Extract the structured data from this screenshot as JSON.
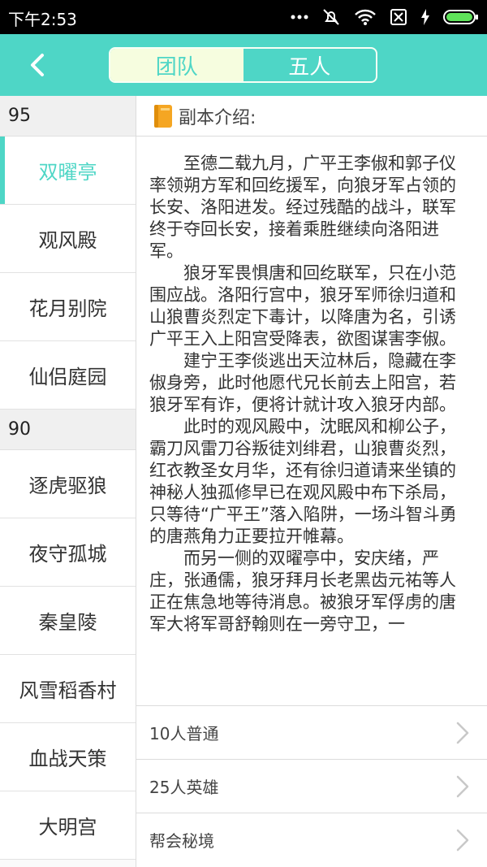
{
  "status": {
    "time": "下午2:53",
    "icons": [
      "more-dots-icon",
      "mute-icon",
      "wifi-icon",
      "sim-off-icon",
      "charging-icon",
      "battery-icon"
    ]
  },
  "header": {
    "tabs": [
      "团队",
      "五人"
    ],
    "active_tab": 0,
    "colors": {
      "accent": "#4ed6c6",
      "active_tab_bg": "#f6fddf"
    }
  },
  "sidebar": {
    "sections": [
      {
        "level": "95",
        "items": [
          "双曜亭",
          "观风殿",
          "花月别院",
          "仙侣庭园"
        ]
      },
      {
        "level": "90",
        "items": [
          "逐虎驱狼",
          "夜守孤城",
          "秦皇陵",
          "风雪稻香村",
          "血战天策",
          "大明宫"
        ]
      }
    ],
    "selected": "双曜亭"
  },
  "intro": {
    "heading": "副本介绍:",
    "paragraphs": [
      "至德二载九月，广平王李俶和郭子仪率领朔方军和回纥援军，向狼牙军占领的长安、洛阳进发。经过残酷的战斗，联军终于夺回长安，接着乘胜继续向洛阳进军。",
      "狼牙军畏惧唐和回纥联军，只在小范围应战。洛阳行宫中，狼牙军师徐归道和山狼曹炎烈定下毒计，以降唐为名，引诱广平王入上阳宫受降表，欲图谋害李俶。",
      "建宁王李倓逃出天泣林后，隐藏在李俶身旁，此时他愿代兄长前去上阳宫，若狼牙军有诈，便将计就计攻入狼牙内部。",
      "此时的观风殿中，沈眠风和柳公子，霸刀风雷刀谷叛徒刘绯君，山狼曹炎烈，红衣教圣女月华，还有徐归道请来坐镇的神秘人独孤修早已在观风殿中布下杀局，只等待“广平王”落入陷阱，一场斗智斗勇的唐燕角力正要拉开帷幕。",
      "而另一侧的双曜亭中，安庆绪，严庄，张通儒，狼牙拜月长老黑齿元祐等人正在焦急地等待消息。被狼牙军俘虏的唐军大将军哥舒翰则在一旁守卫，一"
    ]
  },
  "modes": [
    {
      "label": "10人普通",
      "icon": "chevron-right-icon"
    },
    {
      "label": "25人英雄",
      "icon": "chevron-right-icon"
    },
    {
      "label": "帮会秘境",
      "icon": "chevron-right-icon"
    }
  ]
}
